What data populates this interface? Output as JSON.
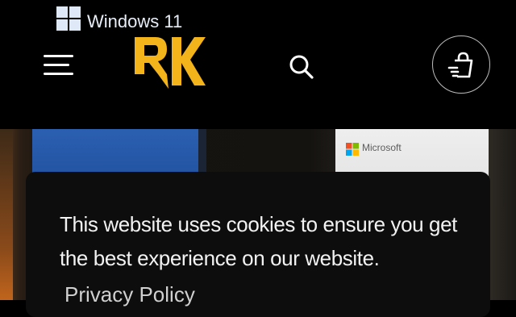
{
  "header": {
    "menu_icon": "hamburger-menu-icon",
    "logo_text": "RK",
    "logo_color": "#f2b31b",
    "search_icon": "search-icon",
    "cart_icon": "shopping-bag-icon"
  },
  "hero": {
    "product_box_left": "Windows 11",
    "product_box_right": "Microsoft"
  },
  "cookie_banner": {
    "message": "This website uses cookies to ensure you get the best experience on our website.",
    "link_label": "Privacy Policy"
  }
}
